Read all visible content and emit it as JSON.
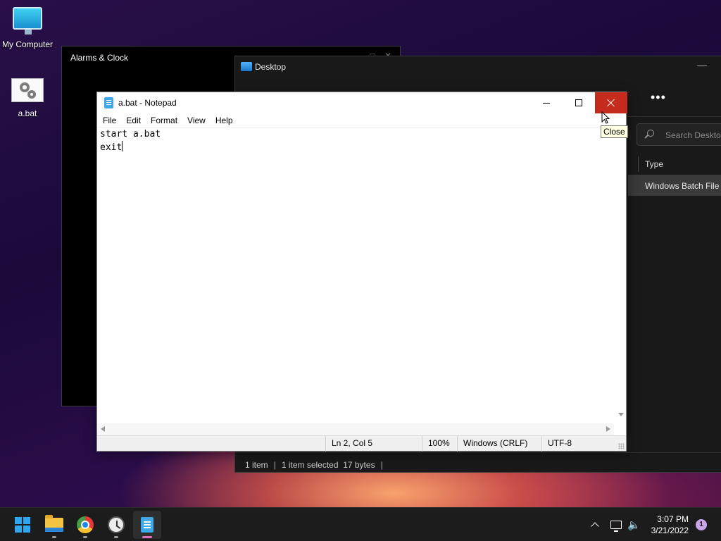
{
  "desktop": {
    "icons": [
      {
        "label": "My Computer",
        "icon": "monitor-icon"
      },
      {
        "label": "a.bat",
        "icon": "batch-file-icon"
      }
    ]
  },
  "alarms_window": {
    "title": "Alarms & Clock"
  },
  "explorer": {
    "title": "Desktop",
    "more_label": "•••",
    "search_placeholder": "Search Desktop",
    "column_header": "Type",
    "selected_row_type": "Windows Batch File",
    "status": {
      "items": "1 item",
      "selected": "1 item selected",
      "size": "17 bytes"
    }
  },
  "notepad": {
    "title": "a.bat - Notepad",
    "menu": [
      "File",
      "Edit",
      "Format",
      "View",
      "Help"
    ],
    "content_lines": [
      "start a.bat",
      "exit"
    ],
    "status": {
      "position": "Ln 2, Col 5",
      "zoom": "100%",
      "line_ending": "Windows (CRLF)",
      "encoding": "UTF-8"
    },
    "close_tooltip": "Close"
  },
  "taskbar": {
    "apps": [
      {
        "name": "start-button",
        "icon": "windows-logo-icon",
        "active": false
      },
      {
        "name": "file-explorer",
        "icon": "folder-icon",
        "active": false,
        "running": true
      },
      {
        "name": "chrome",
        "icon": "chrome-icon",
        "active": false,
        "running": true
      },
      {
        "name": "alarms-clock",
        "icon": "clock-icon",
        "active": false,
        "running": true
      },
      {
        "name": "notepad",
        "icon": "notepad-icon",
        "active": true,
        "running": true
      }
    ],
    "clock": {
      "time": "3:07 PM",
      "date": "3/21/2022"
    },
    "notification_count": "1"
  },
  "colors": {
    "close_button": "#c42b1c",
    "accent": "#2ea7f2",
    "taskbar": "#1c1c1c"
  }
}
